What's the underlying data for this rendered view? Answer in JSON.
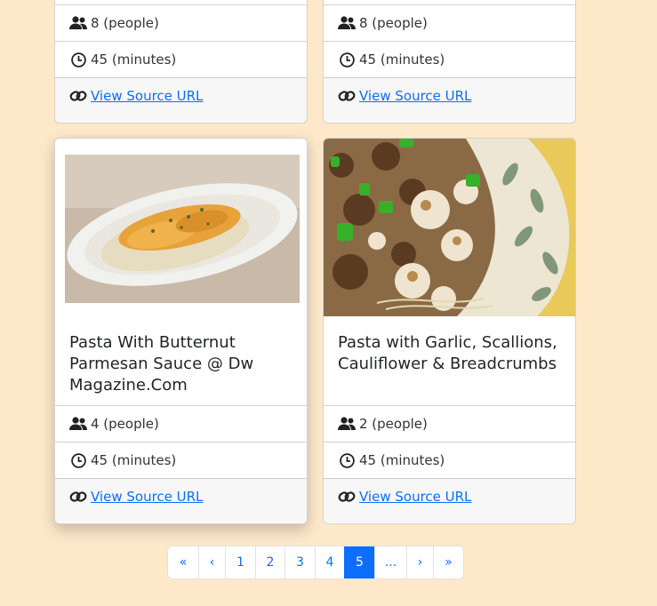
{
  "cards": [
    {
      "servings": "8 (people)",
      "time": "45 (minutes)",
      "link": "View Source URL"
    },
    {
      "servings": "8 (people)",
      "time": "45 (minutes)",
      "link": "View Source URL"
    },
    {
      "title": "Pasta With Butternut Parmesan Sauce @ Dw Magazine.Com",
      "servings": "4 (people)",
      "time": "45 (minutes)",
      "link": "View Source URL"
    },
    {
      "title": "Pasta with Garlic, Scallions, Cauliflower & Breadcrumbs",
      "servings": "2 (people)",
      "time": "45 (minutes)",
      "link": "View Source URL"
    }
  ],
  "pagination": {
    "first": "«",
    "prev": "‹",
    "pages": [
      "1",
      "2",
      "3",
      "4",
      "5"
    ],
    "active": "5",
    "ellipsis": "...",
    "next": "›",
    "last": "»"
  },
  "colors": {
    "background": "#fde8c9",
    "link": "#0d6efd",
    "active_page": "#0d6efd"
  },
  "icons": {
    "servings": "people-icon",
    "time": "clock-icon",
    "link": "link-icon",
    "images": [
      "pasta-butternut-image",
      "pasta-garlic-cauliflower-image"
    ]
  }
}
